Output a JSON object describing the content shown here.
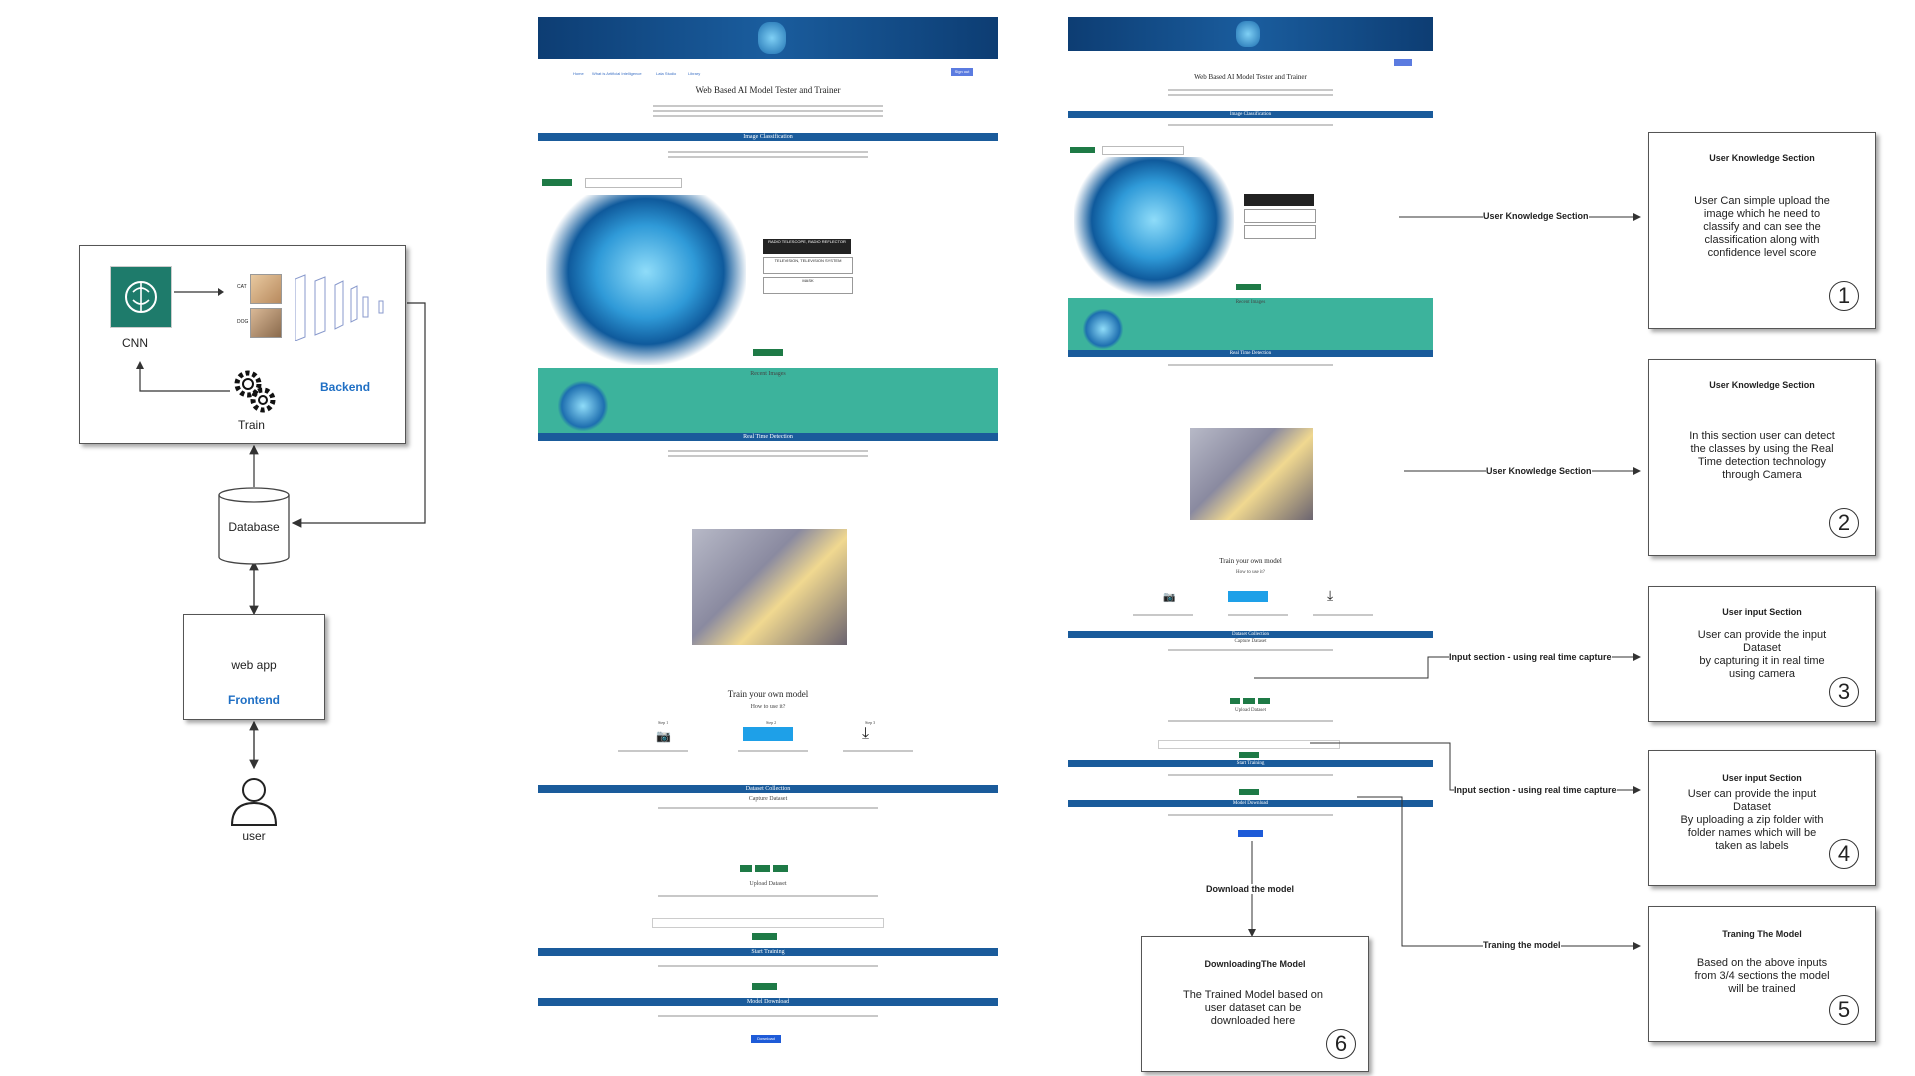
{
  "backend": {
    "cnn_label": "CNN",
    "train_label": "Train",
    "title": "Backend",
    "cat": "CAT",
    "dog": "DOG"
  },
  "database": {
    "label": "Database"
  },
  "frontend": {
    "label": "web app",
    "title": "Frontend"
  },
  "user": {
    "label": "user"
  },
  "mock1": {
    "nav": [
      "Home",
      "What is Artificial Intelligence",
      "Lata Studio",
      "Library"
    ],
    "signin": "Sign out",
    "title": "Web Based AI Model Tester and Trainer",
    "image_classification": "Image Classification",
    "upload_btn": "Upload Image",
    "predictions": [
      "RADIO TELESCOPE, RADIO REFLECTOR",
      "TELEVISION, TELEVISION SYSTEM",
      "MASK"
    ],
    "recent_images": "Recent Images",
    "real_time_detection": "Real Time Detection",
    "train_title": "Train your own model",
    "how_to": "How to use it?",
    "steps": [
      "Step 1",
      "Step 2",
      "Step 3"
    ],
    "start_training_btn": "Start Training",
    "dataset_collection": "Dataset Collection",
    "capture_dataset": "Capture Dataset",
    "upload_dataset": "Upload Dataset",
    "start_training": "Start Training",
    "model_download": "Model Download",
    "download_btn": "Download"
  },
  "mock2": {
    "title": "Web Based AI Model Tester and Trainer",
    "image_classification": "Image Classification",
    "recent_images": "Recent Images",
    "real_time_detection": "Real Time Detection",
    "train_title": "Train your own model",
    "how_to": "How to use it?",
    "dataset_collection": "Dataset Collection",
    "capture_dataset": "Capture Dataset",
    "upload_dataset": "Upload Dataset",
    "start_training": "Start Training",
    "model_download": "Model Download"
  },
  "arrows": {
    "a1": "User Knowledge Section",
    "a2": "User Knowledge Section",
    "a3": "Input section - using real time capture",
    "a4": "Input section - using real time capture",
    "a5": "Traning the model",
    "a6": "Download  the model"
  },
  "callouts": [
    {
      "title": "User Knowledge Section",
      "text": "User Can simple upload the image which he need to classify and can see the classification along with confidence level score",
      "num": "1"
    },
    {
      "title": "User Knowledge Section",
      "text": "In this section user can detect the classes by using the Real Time detection technology through Camera",
      "num": "2"
    },
    {
      "title": "User input Section",
      "text": "User can provide the input Dataset\nby capturing it in real time using camera",
      "num": "3"
    },
    {
      "title": "User input Section",
      "text": "User can provide the input Dataset\nBy uploading a zip folder with folder names which will be taken as labels",
      "num": "4"
    },
    {
      "title": "Traning The Model",
      "text": "Based on the above inputs from 3/4 sections the model will be trained",
      "num": "5"
    },
    {
      "title": "DownloadingThe Model",
      "text": "The Trained Model based on user dataset can be downloaded here",
      "num": "6"
    }
  ]
}
